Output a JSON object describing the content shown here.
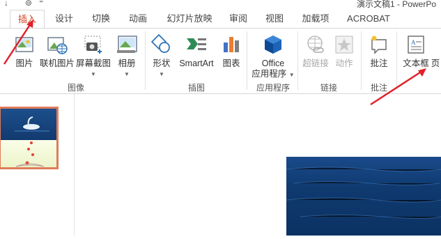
{
  "window": {
    "title": "演示文稿1 - PowerPo"
  },
  "tabs": [
    {
      "label": "插入",
      "active": true
    },
    {
      "label": "设计"
    },
    {
      "label": "切换"
    },
    {
      "label": "动画"
    },
    {
      "label": "幻灯片放映"
    },
    {
      "label": "审阅"
    },
    {
      "label": "视图"
    },
    {
      "label": "加载项"
    },
    {
      "label": "ACROBAT"
    }
  ],
  "ribbon": {
    "groups": {
      "images": "图像",
      "illustrations": "插图",
      "apps": "应用程序",
      "links": "链接",
      "comments": "批注"
    },
    "buttons": {
      "pictures": "图片",
      "online_pictures": "联机图片",
      "screenshot": "屏幕截图",
      "album": "相册",
      "shapes": "形状",
      "smartart": "SmartArt",
      "chart": "图表",
      "office_apps_line1": "Office",
      "office_apps_line2": "应用程序",
      "hyperlink": "超链接",
      "action": "动作",
      "comment": "批注",
      "textbox": "文本框",
      "header_partial": "页"
    }
  },
  "colors": {
    "accent": "#d24726",
    "arrow": "#e0202a",
    "slide_blue": "#0f3a70"
  },
  "icons": [
    "pictures-icon",
    "online-pictures-icon",
    "screenshot-icon",
    "album-icon",
    "shapes-icon",
    "smartart-icon",
    "chart-icon",
    "office-apps-icon",
    "hyperlink-icon",
    "action-icon",
    "comment-icon",
    "textbox-icon"
  ]
}
